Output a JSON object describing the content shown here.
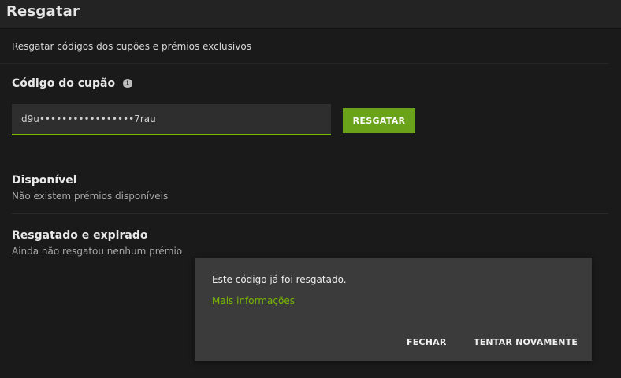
{
  "window": {
    "title": "Resgatar"
  },
  "header": {
    "subtitle": "Resgatar códigos dos cupões e prémios exclusivos"
  },
  "coupon": {
    "label": "Código do cupão",
    "info_icon": "info-icon",
    "value": "d9u•••••••••••••••••7rau",
    "redeem_label": "RESGATAR"
  },
  "available": {
    "title": "Disponível",
    "description": "Não existem prémios disponíveis"
  },
  "redeemed": {
    "title": "Resgatado e expirado",
    "description": "Ainda não resgatou nenhum prémio"
  },
  "toast": {
    "message": "Este código já foi resgatado.",
    "more_info": "Mais informações",
    "close_label": "FECHAR",
    "retry_label": "TENTAR NOVAMENTE"
  },
  "colors": {
    "accent": "#76b900",
    "button": "#6aa31a",
    "background": "#1a1a1a",
    "toast_background": "#3b3b3b"
  }
}
